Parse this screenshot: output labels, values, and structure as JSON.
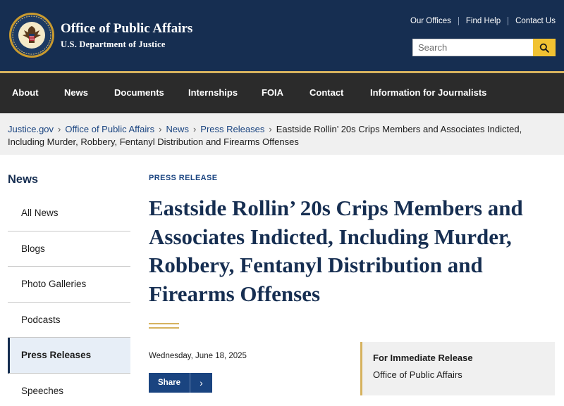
{
  "header": {
    "office_title": "Office of Public Affairs",
    "department": "U.S. Department of Justice",
    "seal_icon": "doj-seal-icon",
    "util_links": [
      "Our Offices",
      "Find Help",
      "Contact Us"
    ],
    "search_placeholder": "Search",
    "search_icon": "search-icon"
  },
  "colors": {
    "header_bg": "#162e51",
    "accent_gold": "#d6b25e",
    "search_button": "#f1c232",
    "nav_bg": "#2b2b2b",
    "link_blue": "#1a4480"
  },
  "nav": [
    "About",
    "News",
    "Documents",
    "Internships",
    "FOIA",
    "Contact",
    "Information for Journalists"
  ],
  "breadcrumb": {
    "items": [
      "Justice.gov",
      "Office of Public Affairs",
      "News",
      "Press Releases"
    ],
    "current": "Eastside Rollin’ 20s Crips Members and Associates Indicted, Including Murder, Robbery, Fentanyl Distribution and Firearms Offenses"
  },
  "sidebar": {
    "title": "News",
    "items": [
      "All News",
      "Blogs",
      "Photo Galleries",
      "Podcasts",
      "Press Releases",
      "Speeches"
    ],
    "active_index": 4
  },
  "article": {
    "kicker": "PRESS RELEASE",
    "headline": "Eastside Rollin’ 20s Crips Members and Associates Indicted, Including Murder, Robbery, Fentanyl Distribution and Firearms Offenses",
    "date": "Wednesday, June 18, 2025",
    "share_label": "Share",
    "share_icon": "chevron-right-icon",
    "release_label": "For Immediate Release",
    "release_office": "Office of Public Affairs"
  }
}
